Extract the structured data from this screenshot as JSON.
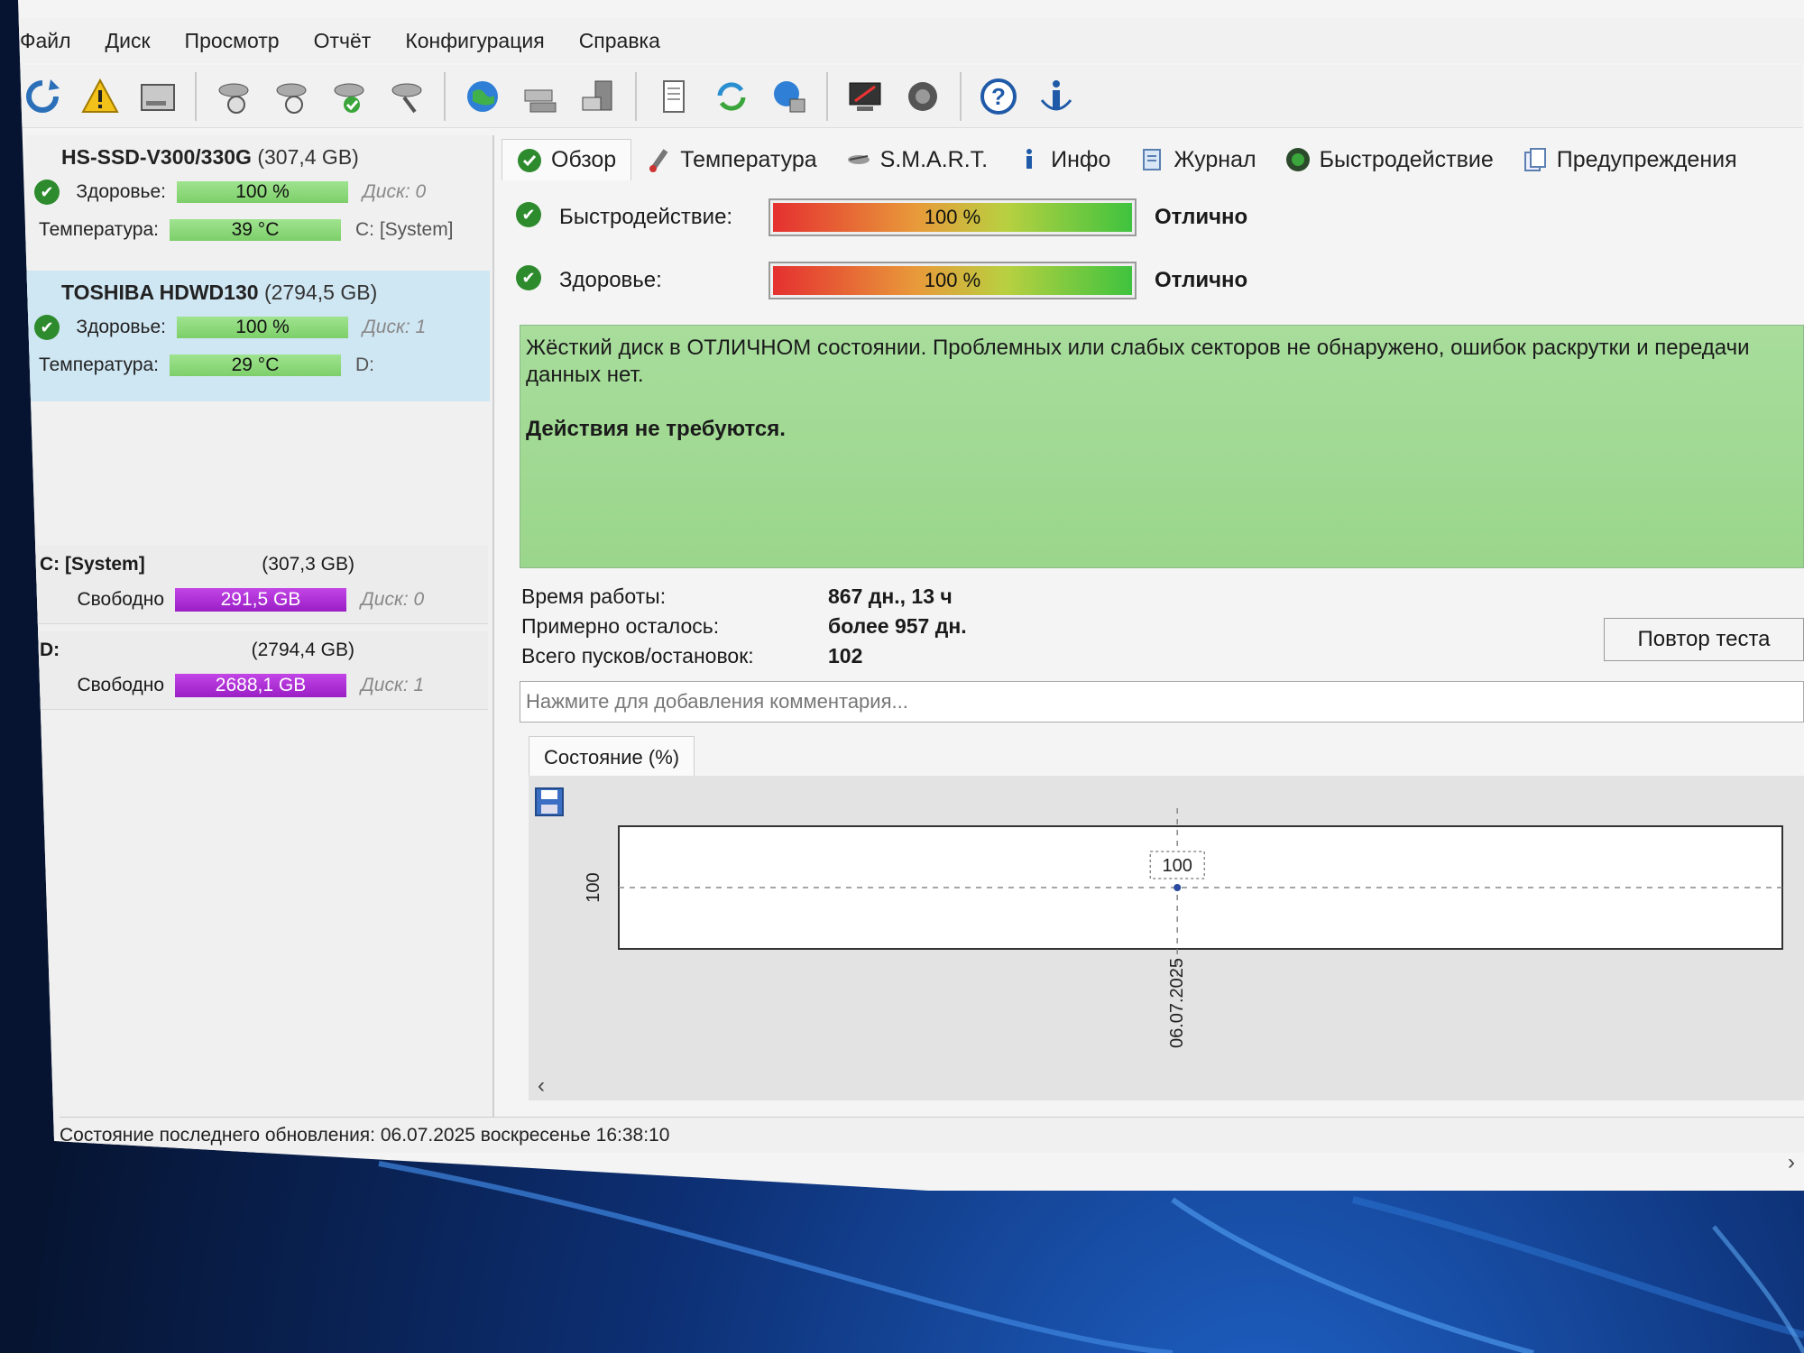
{
  "menu": [
    "Файл",
    "Диск",
    "Просмотр",
    "Отчёт",
    "Конфигурация",
    "Справка"
  ],
  "toolbar": {
    "icons": [
      "refresh-icon",
      "warning-icon",
      "drive-icon",
      "disk-a-icon",
      "disk-b-icon",
      "disk-ok-icon",
      "disk-find-icon",
      "globe-icon",
      "network-icon",
      "server-icon",
      "document-icon",
      "sync-icon",
      "globe-network-icon",
      "monitor-icon",
      "speaker-icon",
      "help-icon",
      "info-icon"
    ]
  },
  "disks": [
    {
      "name": "HS-SSD-V300/330G",
      "capacity": "(307,4 GB)",
      "health_label": "Здоровье:",
      "health": "100 %",
      "health_value": 100,
      "disk_no": "Диск: 0",
      "temp_label": "Температура:",
      "temp": "39 °C",
      "volume": "C: [System]",
      "selected": false
    },
    {
      "name": "TOSHIBA HDWD130",
      "capacity": "(2794,5 GB)",
      "health_label": "Здоровье:",
      "health": "100 %",
      "health_value": 100,
      "disk_no": "Диск: 1",
      "temp_label": "Температура:",
      "temp": "29 °C",
      "volume": "D:",
      "selected": true
    }
  ],
  "volumes": [
    {
      "name": "C: [System]",
      "size": "(307,3 GB)",
      "free_label": "Свободно",
      "free": "291,5 GB",
      "disk_no": "Диск: 0"
    },
    {
      "name": "D:",
      "size": "(2794,4 GB)",
      "free_label": "Свободно",
      "free": "2688,1 GB",
      "disk_no": "Диск: 1"
    }
  ],
  "tabs": [
    {
      "label": "Обзор",
      "icon": "check-circle-icon",
      "active": true
    },
    {
      "label": "Температура",
      "icon": "thermometer-icon",
      "active": false
    },
    {
      "label": "S.M.A.R.T.",
      "icon": "smart-icon",
      "active": false
    },
    {
      "label": "Инфо",
      "icon": "info-icon",
      "active": false
    },
    {
      "label": "Журнал",
      "icon": "journal-icon",
      "active": false
    },
    {
      "label": "Быстродействие",
      "icon": "speed-icon",
      "active": false
    },
    {
      "label": "Предупреждения",
      "icon": "warnings-icon",
      "active": false
    }
  ],
  "overview": {
    "performance_label": "Быстродействие:",
    "performance": "100 %",
    "performance_value": 100,
    "performance_rating": "Отлично",
    "health_label": "Здоровье:",
    "health": "100 %",
    "health_value": 100,
    "health_rating": "Отлично",
    "status_text": "Жёсткий диск в ОТЛИЧНОМ состоянии. Проблемных или слабых секторов не обнаружено, ошибок раскрутки и передачи данных нет.",
    "action_text": "Действия не требуются.",
    "uptime_label": "Время работы:",
    "uptime": "867 дн., 13 ч",
    "remaining_label": "Примерно осталось:",
    "remaining": "более 957 дн.",
    "starts_label": "Всего пусков/остановок:",
    "starts": "102",
    "retest_button": "Повтор теста",
    "comment_placeholder": "Нажмите для добавления комментария..."
  },
  "chart_tab": "Состояние (%)",
  "chart_data": {
    "type": "line",
    "x": [
      "06.07.2025"
    ],
    "series": [
      {
        "values": [
          100
        ]
      }
    ],
    "yticks": [
      "100"
    ],
    "point_label": "100"
  },
  "statusbar": "Состояние последнего обновления: 06.07.2025 воскресенье 16:38:10",
  "colors": {
    "ok_green": "#2d8a2d",
    "health_bar": "#8fdc7c",
    "free_bar": "#b030d8",
    "status_bg": "#a3da95"
  }
}
